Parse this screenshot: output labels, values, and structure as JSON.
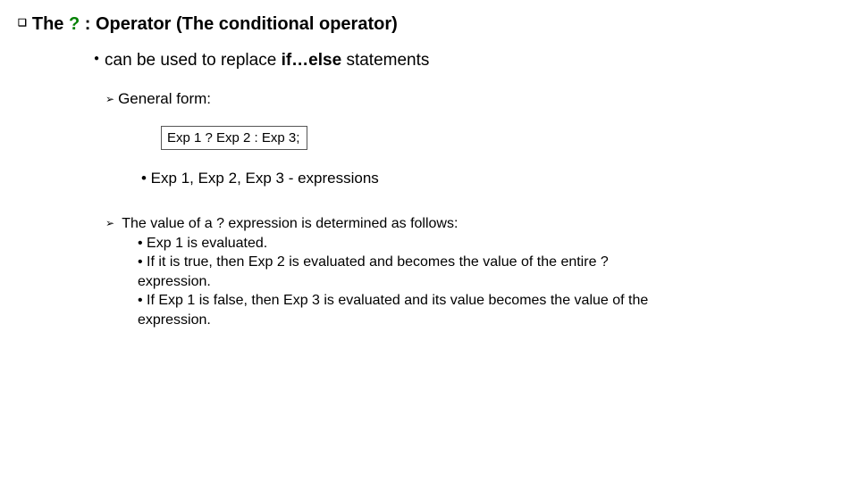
{
  "title": {
    "part1": "The ",
    "qmark": "?",
    "part2": " : Operator  (The conditional operator)"
  },
  "line1": {
    "pre": "can be used to replace ",
    "bold": "if…else",
    "post": " statements"
  },
  "line2": "General form:",
  "code": "Exp 1 ? Exp 2 : Exp 3;",
  "line3": "• Exp 1, Exp 2, Exp 3 - expressions",
  "block": {
    "l1": "The value of a ? expression is determined as follows:",
    "l2": "• Exp 1 is evaluated.",
    "l3": "• If it is true, then Exp 2 is evaluated and becomes the value of the entire ?",
    "l4": "expression.",
    "l5": "• If Exp 1 is false, then Exp 3 is evaluated and its value becomes the value of the",
    "l6": "expression."
  }
}
